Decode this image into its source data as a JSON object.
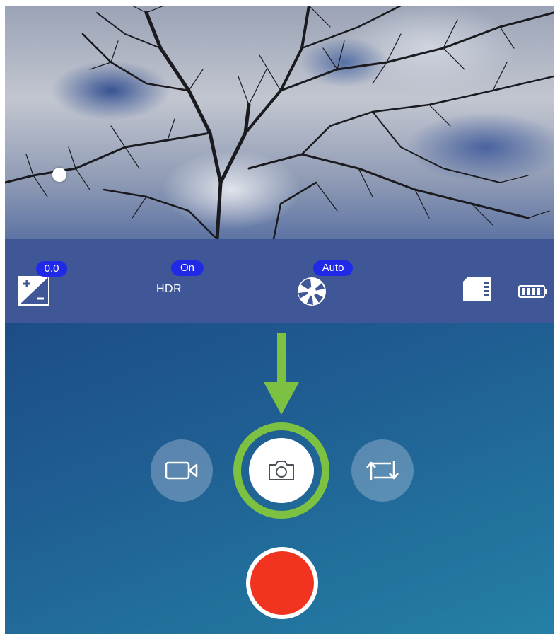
{
  "viewfinder": {
    "exposure_slider_level": 0.29
  },
  "settings": {
    "exposure": {
      "icon": "exposure-compensation-icon",
      "value": "0.0"
    },
    "hdr": {
      "label": "HDR",
      "value": "On"
    },
    "flash": {
      "icon": "aperture-icon",
      "value": "Auto"
    },
    "storage": {
      "icon": "sd-card-icon"
    },
    "battery": {
      "icon": "battery-icon"
    }
  },
  "controls": {
    "video_mode": {
      "icon": "video-camera-icon"
    },
    "photo_mode": {
      "icon": "camera-icon",
      "highlighted": true
    },
    "switch_camera": {
      "icon": "switch-camera-icon"
    },
    "record": {
      "icon": "record-button"
    },
    "annotation_arrow": {
      "icon": "arrow-down-icon"
    }
  },
  "colors": {
    "settings_bar": "#3f5697",
    "badge": "#1f29e6",
    "highlight": "#7dc142",
    "record": "#f0341f"
  }
}
